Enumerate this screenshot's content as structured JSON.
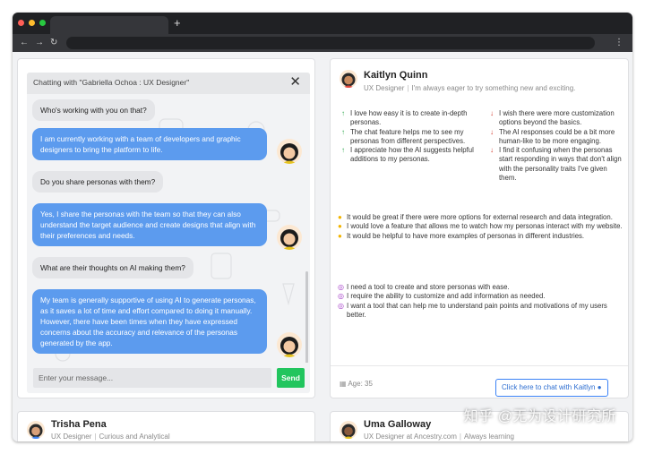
{
  "browser": {
    "new_tab": "+",
    "menu": "⋮",
    "back": "←",
    "forward": "→",
    "reload": "↻"
  },
  "chat": {
    "title": "Chatting with \"Gabriella Ochoa : UX Designer\"",
    "close": "✕",
    "messages": [
      {
        "role": "question",
        "text": "Who's working with you on that?"
      },
      {
        "role": "answer",
        "text": "I am currently working with a team of developers and graphic designers to bring the platform to life."
      },
      {
        "role": "question",
        "text": "Do you share personas with them?"
      },
      {
        "role": "answer",
        "text": "Yes, I share the personas with the team so that they can also understand the target audience and create designs that align with their preferences and needs."
      },
      {
        "role": "question",
        "text": "What are their thoughts on AI making them?"
      },
      {
        "role": "answer",
        "text": "My team is generally supportive of using AI to generate personas, as it saves a lot of time and effort compared to doing it manually. However, there have been times when they have expressed concerns about the accuracy and relevance of the personas generated by the app."
      }
    ],
    "input_placeholder": "Enter your message...",
    "send_label": "Send"
  },
  "profile": {
    "name": "Kaitlyn Quinn",
    "role": "UX Designer",
    "quote": "I'm always eager to try something new and exciting.",
    "likes": [
      "I love how easy it is to create in-depth personas.",
      "The chat feature helps me to see my personas from different perspectives.",
      "I appreciate how the AI suggests helpful additions to my personas."
    ],
    "dislikes": [
      "I wish there were more customization options beyond the basics.",
      "The AI responses could be a bit more human-like to be more engaging.",
      "I find it confusing when the personas start responding in ways that don't align with the personality traits I've given them."
    ],
    "ideas": [
      "It would be great if there were more options for external research and data integration.",
      "I would love a feature that allows me to watch how my personas interact with my website.",
      "It would be helpful to have more examples of personas in different industries."
    ],
    "needs": [
      "I need a tool to create and store personas with ease.",
      "I require the ability to customize and add information as needed.",
      "I want a tool that can help me to understand pain points and motivations of my users better."
    ],
    "age": "Age: 35",
    "chat_button": "Click here to chat with Kaitlyn"
  },
  "bottom_cards": [
    {
      "name": "Trisha Pena",
      "role": "UX Designer",
      "desc": "Curious and Analytical"
    },
    {
      "name": "Uma Galloway",
      "role": "UX Designer at Ancestry.com",
      "desc": "Always learning"
    }
  ],
  "icons": {
    "like": "▲",
    "dislike": "▼",
    "idea": "💡",
    "need": "◎",
    "calendar": "▦",
    "chat": "💬"
  },
  "colors": {
    "accent": "#5c9bee",
    "send": "#22c55e",
    "up": "#2fa84f",
    "down": "#d33a2c"
  },
  "watermark": "知乎 @无为设计研究所"
}
